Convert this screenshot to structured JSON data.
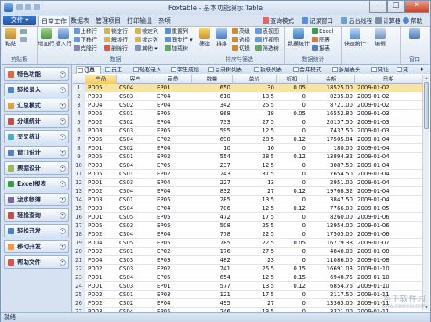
{
  "window": {
    "title": "Foxtable - 基本功能演示.Table"
  },
  "menu": {
    "file": "文件",
    "tabs": [
      "日常工作",
      "数据表",
      "管理项目",
      "打印输出",
      "杂项"
    ],
    "right_tools": [
      "查询模式",
      "记录窗口",
      "后台线程",
      "计算器",
      "帮助"
    ]
  },
  "ribbon": {
    "groups": [
      "剪贴板",
      "数据",
      "排序与筛选",
      "数据统计",
      "窗口"
    ],
    "clipboard": [
      "粘贴",
      "增加行",
      "插入行"
    ],
    "data_col1": [
      "上移行",
      "下移行",
      "克隆行"
    ],
    "data_col2": [
      "锁定行",
      "解锁行",
      "删除行"
    ],
    "data_col3": [
      "锁定列",
      "锁定列",
      "其他"
    ],
    "data_col4": [
      "重置列",
      "同步行",
      "加载树"
    ],
    "sort_big": [
      "筛选",
      "排序"
    ],
    "sort_small": [
      "高级",
      "选择",
      "切换"
    ],
    "sort_col": [
      "表视图",
      "行视图",
      "筛选树"
    ],
    "stats": [
      "数据统计",
      "Excel",
      "图表",
      "报表"
    ],
    "misc": [
      "快速统计",
      "编辑",
      "窗口"
    ]
  },
  "sidebar": {
    "items": [
      "特色功能",
      "轻松录入",
      "汇总模式",
      "分组统计",
      "交叉统计",
      "窗口设计",
      "票据设计",
      "Excel报表",
      "流水帐簿",
      "轻松查询",
      "轻松开发",
      "移动开发",
      "帮助文件"
    ]
  },
  "table_tabs": [
    "订单",
    "员工",
    "轻松录入",
    "学生成绩",
    "目录树列表",
    "扳联列表",
    "合并模式",
    "多层表头",
    "凭证",
    "凭..."
  ],
  "grid": {
    "columns": [
      "产品",
      "客户",
      "雇员",
      "数量",
      "单价",
      "折扣",
      "金额",
      "日期"
    ],
    "rows": [
      [
        "1",
        "PD05",
        "CS04",
        "EP01",
        "650",
        "30",
        "0.05",
        "18525.00",
        "2009-01-02"
      ],
      [
        "2",
        "PD03",
        "CS03",
        "EP04",
        "610",
        "13.5",
        "0",
        "8235.00",
        "2009-01-02"
      ],
      [
        "3",
        "PD04",
        "CS02",
        "EP04",
        "342",
        "25.5",
        "0",
        "8721.00",
        "2009-01-02"
      ],
      [
        "4",
        "PD05",
        "CS01",
        "EP05",
        "968",
        "18",
        "0.05",
        "16552.80",
        "2009-01-03"
      ],
      [
        "5",
        "PD02",
        "CS02",
        "EP04",
        "733",
        "27.5",
        "0",
        "20157.50",
        "2009-01-03"
      ],
      [
        "6",
        "PD03",
        "CS03",
        "EP05",
        "595",
        "12.5",
        "0",
        "7437.50",
        "2009-01-03"
      ],
      [
        "7",
        "PD05",
        "CS04",
        "EP02",
        "698",
        "28.5",
        "0.12",
        "17505.84",
        "2009-01-04"
      ],
      [
        "8",
        "PD01",
        "CS02",
        "EP04",
        "10",
        "16",
        "0",
        "180.00",
        "2009-01-04"
      ],
      [
        "9",
        "PD05",
        "CS01",
        "EP02",
        "554",
        "28.5",
        "0.12",
        "13894.32",
        "2009-01-04"
      ],
      [
        "10",
        "PD03",
        "CS04",
        "EP05",
        "237",
        "12.5",
        "0",
        "3087.50",
        "2009-01-04"
      ],
      [
        "11",
        "PD05",
        "CS01",
        "EP02",
        "243",
        "31.5",
        "0",
        "7654.50",
        "2009-01-04"
      ],
      [
        "12",
        "PD01",
        "CS03",
        "EP04",
        "227",
        "13",
        "0",
        "2951.00",
        "2009-01-04"
      ],
      [
        "13",
        "PD02",
        "CS04",
        "EP04",
        "832",
        "27",
        "0.12",
        "19768.32",
        "2009-01-04"
      ],
      [
        "14",
        "PD03",
        "CS01",
        "EP05",
        "285",
        "13.5",
        "0",
        "3847.50",
        "2009-01-04"
      ],
      [
        "15",
        "PD03",
        "CS04",
        "EP04",
        "706",
        "12.5",
        "0.12",
        "7766.00",
        "2009-01-05"
      ],
      [
        "16",
        "PD01",
        "CS05",
        "EP05",
        "472",
        "17.5",
        "0",
        "8260.00",
        "2009-01-06"
      ],
      [
        "17",
        "PD05",
        "CS03",
        "EP05",
        "508",
        "25.5",
        "0",
        "12954.00",
        "2009-01-06"
      ],
      [
        "18",
        "PD02",
        "CS04",
        "EP04",
        "778",
        "22.5",
        "0",
        "17505.00",
        "2009-01-06"
      ],
      [
        "19",
        "PD04",
        "CS05",
        "EP05",
        "785",
        "22.5",
        "0.05",
        "16779.38",
        "2009-01-07"
      ],
      [
        "20",
        "PD02",
        "CS01",
        "EP02",
        "176",
        "27.5",
        "0",
        "4840.00",
        "2009-01-08"
      ],
      [
        "21",
        "PD04",
        "CS03",
        "EP03",
        "482",
        "23",
        "0",
        "11086.00",
        "2009-01-08"
      ],
      [
        "22",
        "PD02",
        "CS03",
        "EP02",
        "741",
        "25.5",
        "0.15",
        "16691.03",
        "2009-01-10"
      ],
      [
        "23",
        "PD01",
        "CS04",
        "EP05",
        "654",
        "12.5",
        "0.15",
        "6948.75",
        "2009-01-10"
      ],
      [
        "24",
        "PD01",
        "CS03",
        "EP01",
        "577",
        "13.5",
        "0.12",
        "6854.76",
        "2009-01-10"
      ],
      [
        "25",
        "PD02",
        "CS01",
        "EP03",
        "121",
        "17.5",
        "0",
        "2117.50",
        "2009-01-11"
      ],
      [
        "26",
        "PD02",
        "CS02",
        "EP04",
        "495",
        "27",
        "0",
        "13365.00",
        "2009-01-11"
      ],
      [
        "27",
        "PD03",
        "CS04",
        "EP05",
        "246",
        "13.5",
        "0",
        "3321.00",
        "2009-01-11"
      ]
    ]
  },
  "status": {
    "text": "就绪"
  },
  "watermark": {
    "line1": "当下软件园",
    "line2": "www.downxia.com"
  },
  "colors": {
    "accent": "#2d63b5",
    "selected_row": "#f9e3a0",
    "ribbon_bg": "#dde7f3"
  }
}
